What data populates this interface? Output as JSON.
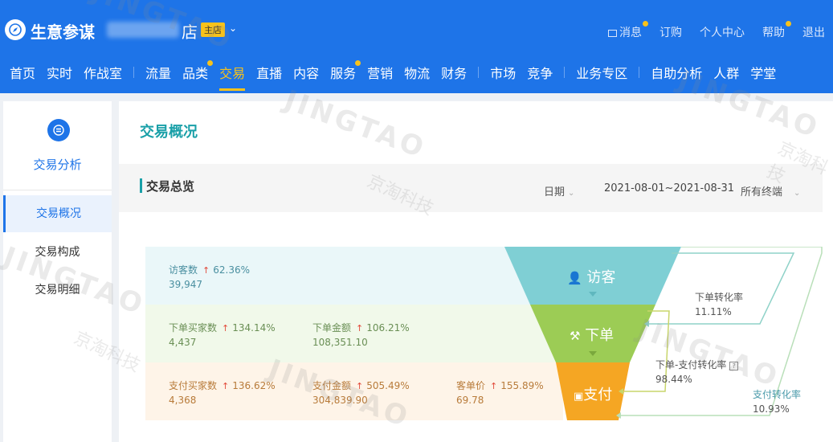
{
  "header": {
    "logo_text": "生意参谋",
    "shop_suffix": "店",
    "shop_badge": "主店",
    "top_links": [
      {
        "label": "消息",
        "dot": true,
        "icon": "message-icon"
      },
      {
        "label": "订购",
        "dot": false
      },
      {
        "label": "个人中心",
        "dot": false
      },
      {
        "label": "帮助",
        "dot": true
      },
      {
        "label": "退出",
        "dot": false
      }
    ],
    "nav": [
      {
        "label": "首页"
      },
      {
        "label": "实时"
      },
      {
        "label": "作战室"
      },
      {
        "sep": true
      },
      {
        "label": "流量"
      },
      {
        "label": "品类",
        "dot": true
      },
      {
        "label": "交易",
        "active": true
      },
      {
        "label": "直播"
      },
      {
        "label": "内容"
      },
      {
        "label": "服务",
        "dot": true
      },
      {
        "label": "营销"
      },
      {
        "label": "物流"
      },
      {
        "label": "财务"
      },
      {
        "sep": true
      },
      {
        "label": "市场"
      },
      {
        "label": "竞争"
      },
      {
        "sep": true
      },
      {
        "label": "业务专区"
      },
      {
        "sep": true
      },
      {
        "label": "自助分析"
      },
      {
        "label": "人群"
      },
      {
        "label": "学堂"
      }
    ]
  },
  "sidebar": {
    "title": "交易分析",
    "items": [
      {
        "label": "交易概况",
        "active": true
      },
      {
        "label": "交易构成"
      },
      {
        "label": "交易明细"
      }
    ]
  },
  "main": {
    "title": "交易概况",
    "section_title": "交易总览",
    "date_label": "日期",
    "date_range": "2021-08-01~2021-08-31",
    "terminal": "所有终端"
  },
  "metrics": {
    "visitors": {
      "label": "访客数",
      "change": "62.36%",
      "value": "39,947"
    },
    "order_buyers": {
      "label": "下单买家数",
      "change": "134.14%",
      "value": "4,437"
    },
    "order_amount": {
      "label": "下单金额",
      "change": "106.21%",
      "value": "108,351.10"
    },
    "pay_buyers": {
      "label": "支付买家数",
      "change": "136.62%",
      "value": "4,368"
    },
    "pay_amount": {
      "label": "支付金额",
      "change": "505.49%",
      "value": "304,839.90"
    },
    "avg_price": {
      "label": "客单价",
      "change": "155.89%",
      "value": "69.78"
    }
  },
  "funnel": {
    "stage_visitor": "访客",
    "stage_order": "下单",
    "stage_pay": "支付",
    "order_rate_label": "下单转化率",
    "order_rate_value": "11.11%",
    "order_pay_rate_label": "下单-支付转化率",
    "order_pay_rate_value": "98.44%",
    "pay_rate_label": "支付转化率",
    "pay_rate_value": "10.93%",
    "colors": {
      "visitor": "#7fcfd4",
      "order": "#9ccc55",
      "pay": "#f5a623"
    }
  },
  "watermark": {
    "text": "JINGTAO",
    "cn": "京淘科技"
  }
}
